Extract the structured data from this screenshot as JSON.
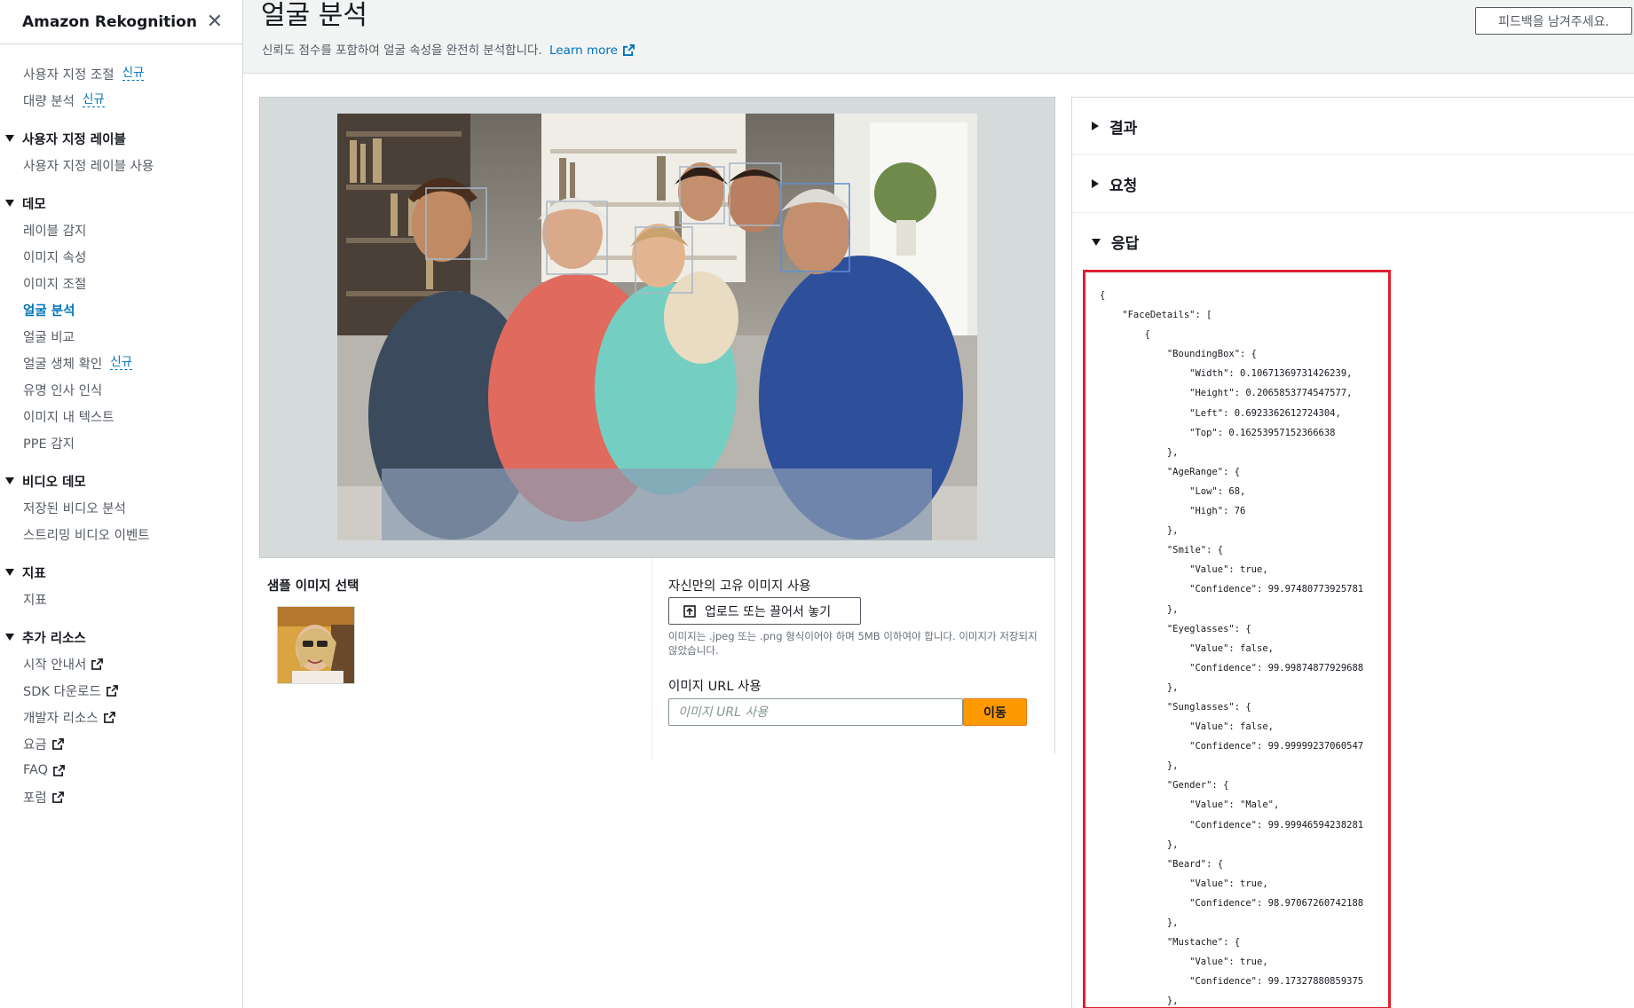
{
  "sidebar": {
    "title": "Amazon Rekognition",
    "close_icon": "close-icon",
    "top_items": [
      {
        "label": "사용자 지정 조절",
        "badge": "신규"
      },
      {
        "label": "대량 분석",
        "badge": "신규"
      }
    ],
    "sections": [
      {
        "title": "사용자 지정 레이블",
        "items": [
          {
            "label": "사용자 지정 레이블 사용"
          }
        ]
      },
      {
        "title": "데모",
        "items": [
          {
            "label": "레이블 감지"
          },
          {
            "label": "이미지 속성"
          },
          {
            "label": "이미지 조절"
          },
          {
            "label": "얼굴 분석",
            "active": true
          },
          {
            "label": "얼굴 비교"
          },
          {
            "label": "얼굴 생체 확인",
            "badge": "신규"
          },
          {
            "label": "유명 인사 인식"
          },
          {
            "label": "이미지 내 텍스트"
          },
          {
            "label": "PPE 감지"
          }
        ]
      },
      {
        "title": "비디오 데모",
        "items": [
          {
            "label": "저장된 비디오 분석"
          },
          {
            "label": "스트리밍 비디오 이벤트"
          }
        ]
      },
      {
        "title": "지표",
        "items": [
          {
            "label": "지표"
          }
        ]
      },
      {
        "title": "추가 리소스",
        "items": [
          {
            "label": "시작 안내서",
            "external": true
          },
          {
            "label": "SDK 다운로드",
            "external": true
          },
          {
            "label": "개발자 리소스",
            "external": true
          },
          {
            "label": "요금",
            "external": true
          },
          {
            "label": "FAQ",
            "external": true
          },
          {
            "label": "포럼",
            "external": true
          }
        ]
      }
    ]
  },
  "header": {
    "title": "얼굴 분석",
    "description": "신뢰도 점수를 포함하여 얼굴 속성을 완전히 분석합니다.",
    "learn_more": "Learn more",
    "feedback_label": "피드백을 남겨주세요."
  },
  "image": {
    "alt": "family-photo",
    "face_box_color": "#aab7c4"
  },
  "sample": {
    "label": "샘플 이미지 선택"
  },
  "own_image": {
    "label": "자신만의 고유 이미지 사용",
    "upload_label": "업로드 또는 끌어서 놓기",
    "note": "이미지는 .jpeg 또는 .png 형식이어야 하며 5MB 이하여야 합니다. 이미지가 저장되지 않았습니다.",
    "url_label": "이미지 URL 사용",
    "url_placeholder": "이미지 URL 사용",
    "go_label": "이동"
  },
  "right_panel": {
    "sections": [
      {
        "label": "결과",
        "expanded": false
      },
      {
        "label": "요청",
        "expanded": false
      },
      {
        "label": "응답",
        "expanded": true
      }
    ],
    "response_json": "{\n    \"FaceDetails\": [\n        {\n            \"BoundingBox\": {\n                \"Width\": 0.10671369731426239,\n                \"Height\": 0.2065853774547577,\n                \"Left\": 0.6923362612724304,\n                \"Top\": 0.16253957152366638\n            },\n            \"AgeRange\": {\n                \"Low\": 68,\n                \"High\": 76\n            },\n            \"Smile\": {\n                \"Value\": true,\n                \"Confidence\": 99.97480773925781\n            },\n            \"Eyeglasses\": {\n                \"Value\": false,\n                \"Confidence\": 99.99874877929688\n            },\n            \"Sunglasses\": {\n                \"Value\": false,\n                \"Confidence\": 99.99999237060547\n            },\n            \"Gender\": {\n                \"Value\": \"Male\",\n                \"Confidence\": 99.99946594238281\n            },\n            \"Beard\": {\n                \"Value\": true,\n                \"Confidence\": 98.97067260742188\n            },\n            \"Mustache\": {\n                \"Value\": true,\n                \"Confidence\": 99.17327880859375\n            },"
  }
}
